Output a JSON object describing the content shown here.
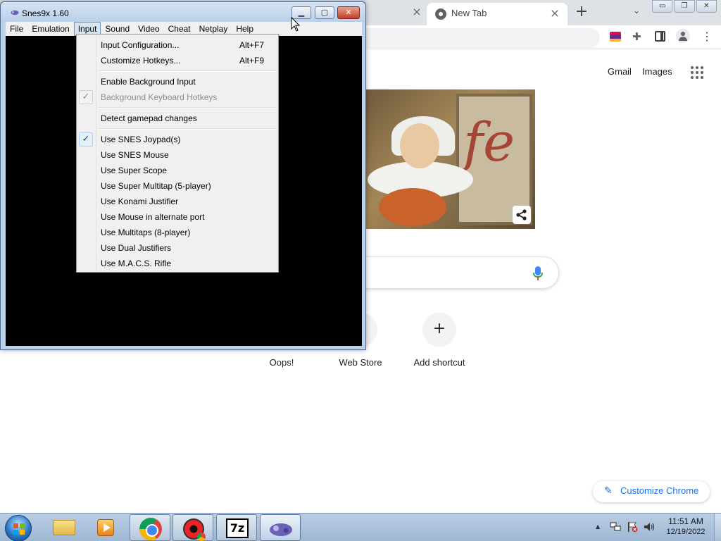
{
  "chrome": {
    "tab_title": "New Tab",
    "tab_close": "×",
    "new_tab": "+",
    "top_links": {
      "gmail": "Gmail",
      "images": "Images"
    },
    "shortcuts": [
      {
        "label": "Oops!"
      },
      {
        "label": "Web Store"
      },
      {
        "label": "Add shortcut",
        "icon_glyph": "+"
      }
    ],
    "customize_label": "Customize Chrome",
    "window_controls": {
      "minimize": "▭",
      "restore": "❐",
      "close": "✕"
    }
  },
  "snes": {
    "title": "Snes9x 1.60",
    "controls": {
      "minimize": "▁",
      "maximize": "▢",
      "close": "✕"
    },
    "menubar": [
      "File",
      "Emulation",
      "Input",
      "Sound",
      "Video",
      "Cheat",
      "Netplay",
      "Help"
    ],
    "active_menu": "Input",
    "input_menu": [
      {
        "label": "Input Configuration...",
        "shortcut": "Alt+F7",
        "checked": false,
        "disabled": false
      },
      {
        "label": "Customize Hotkeys...",
        "shortcut": "Alt+F9",
        "checked": false,
        "disabled": false
      },
      {
        "label": "Enable Background Input",
        "shortcut": "",
        "checked": false,
        "disabled": false
      },
      {
        "label": "Background Keyboard Hotkeys",
        "shortcut": "",
        "checked": true,
        "disabled": true
      },
      {
        "label": "Detect gamepad changes",
        "shortcut": "",
        "checked": false,
        "disabled": false
      },
      {
        "label": "Use SNES Joypad(s)",
        "shortcut": "",
        "checked": true,
        "disabled": false
      },
      {
        "label": "Use SNES Mouse",
        "shortcut": "",
        "checked": false,
        "disabled": false
      },
      {
        "label": "Use Super Scope",
        "shortcut": "",
        "checked": false,
        "disabled": false
      },
      {
        "label": "Use Super Multitap (5-player)",
        "shortcut": "",
        "checked": false,
        "disabled": false
      },
      {
        "label": "Use Konami Justifier",
        "shortcut": "",
        "checked": false,
        "disabled": false
      },
      {
        "label": "Use Mouse in alternate port",
        "shortcut": "",
        "checked": false,
        "disabled": false
      },
      {
        "label": "Use Multitaps (8-player)",
        "shortcut": "",
        "checked": false,
        "disabled": false
      },
      {
        "label": "Use Dual Justifiers",
        "shortcut": "",
        "checked": false,
        "disabled": false
      },
      {
        "label": "Use M.A.C.S. Rifle",
        "shortcut": "",
        "checked": false,
        "disabled": false
      }
    ],
    "check_glyph": "✓"
  },
  "taskbar": {
    "sevenzip_label": "7z",
    "clock": {
      "time": "11:51 AM",
      "date": "12/19/2022"
    },
    "tray_arrow": "▲"
  },
  "colors": {
    "accent_blue": "#1a73e8",
    "snes_title_bg": "#bcd2ea",
    "menu_bg": "#f0f0f0",
    "taskbar_bg": "#a9c0da"
  }
}
